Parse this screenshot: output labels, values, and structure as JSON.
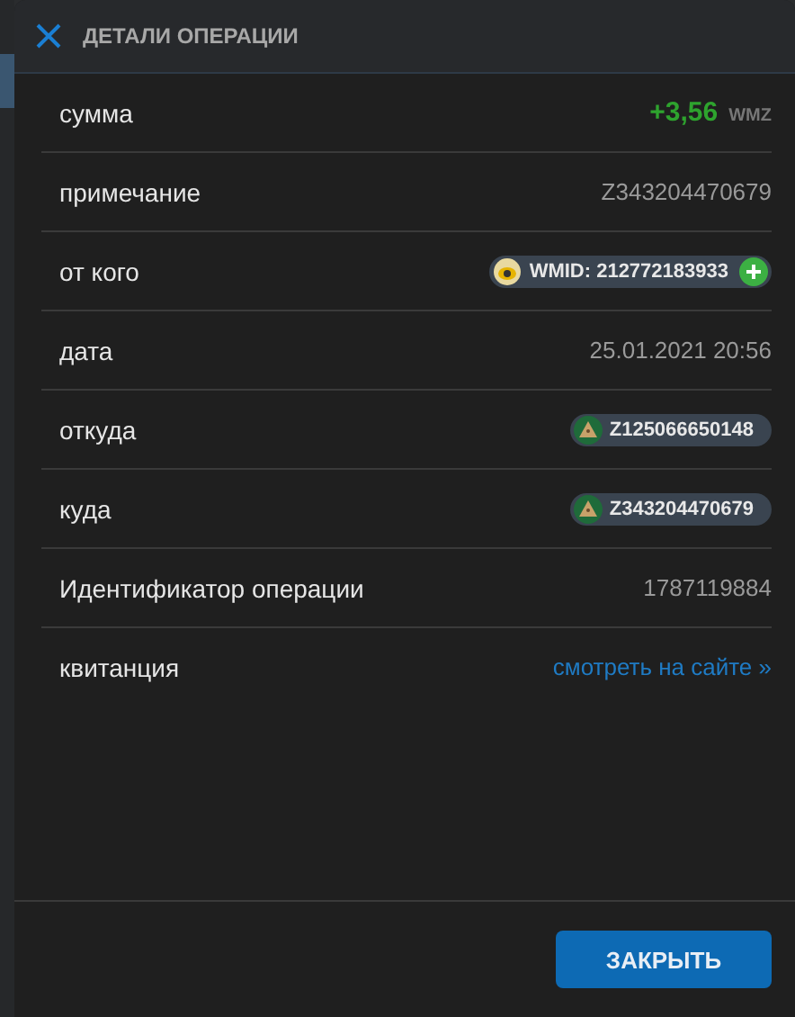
{
  "dialog": {
    "title": "ДЕТАЛИ ОПЕРАЦИИ"
  },
  "rows": [
    {
      "kind": "amount",
      "label": "сумма",
      "value": "+3,56",
      "unit": "WMZ"
    },
    {
      "kind": "text",
      "label": "примечание",
      "value": "Z343204470679"
    },
    {
      "kind": "wmid",
      "label": "от кого",
      "value": "WMID: 212772183933"
    },
    {
      "kind": "text",
      "label": "дата",
      "value": "25.01.2021 20:56"
    },
    {
      "kind": "purse",
      "label": "откуда",
      "value": "Z125066650148"
    },
    {
      "kind": "purse",
      "label": "куда",
      "value": "Z343204470679"
    },
    {
      "kind": "text",
      "label": "Идентификатор операции",
      "value": "1787119884"
    },
    {
      "kind": "link",
      "label": "квитанция",
      "value": "смотреть на сайте »"
    }
  ],
  "buttons": [
    {
      "label": "ЗАКРЫТЬ"
    }
  ]
}
